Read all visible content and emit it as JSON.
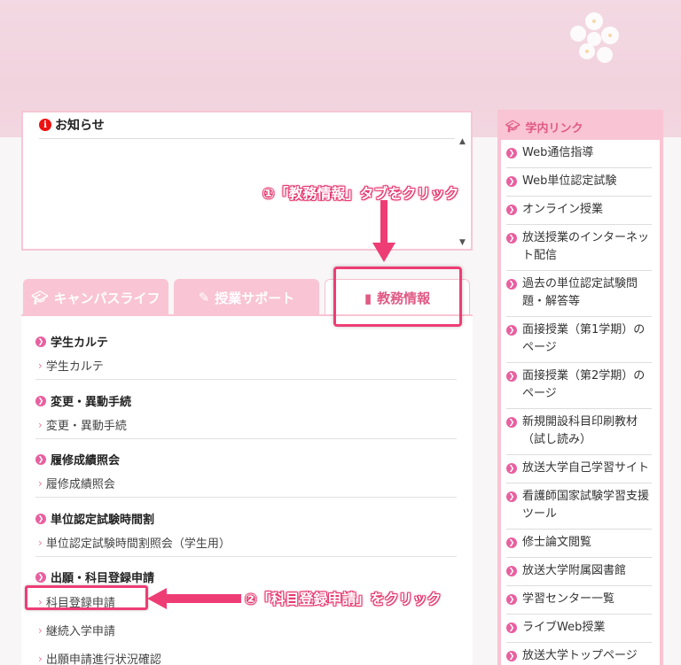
{
  "notice": {
    "title": "お知らせ"
  },
  "tabs": [
    {
      "label": "キャンパスライフ",
      "icon": "graduation-cap-icon"
    },
    {
      "label": "授業サポート",
      "icon": "pencil-icon"
    },
    {
      "label": "教務情報",
      "icon": "book-icon"
    }
  ],
  "callouts": {
    "step1": "①「教務情報」タブをクリック",
    "step2": "②「科目登録申請」をクリック"
  },
  "sections": [
    {
      "heading": "学生カルテ",
      "links": [
        "学生カルテ"
      ]
    },
    {
      "heading": "変更・異動手続",
      "links": [
        "変更・異動手続"
      ]
    },
    {
      "heading": "履修成績照会",
      "links": [
        "履修成績照会"
      ]
    },
    {
      "heading": "単位認定試験時間割",
      "links": [
        "単位認定試験時間割照会（学生用）"
      ]
    },
    {
      "heading": "出願・科目登録申請",
      "links": [
        "科目登録申請",
        "継続入学申請",
        "出願申請進行状況確認"
      ]
    }
  ],
  "sidebar": {
    "title": "学内リンク",
    "items": [
      "Web通信指導",
      "Web単位認定試験",
      "オンライン授業",
      "放送授業のインターネット配信",
      "過去の単位認定試験問題・解答等",
      "面接授業（第1学期）のページ",
      "面接授業（第2学期）のページ",
      "新規開設科目印刷教材（試し読み）",
      "放送大学自己学習サイト",
      "看護師国家試験学習支援ツール",
      "修士論文閲覧",
      "放送大学附属図書館",
      "学習センター一覧",
      "ライブWeb授業",
      "放送大学トップページ"
    ]
  },
  "colors": {
    "accent": "#ee3d75",
    "tab_pink": "#f9c4d3",
    "bullet": "#e860a0"
  }
}
